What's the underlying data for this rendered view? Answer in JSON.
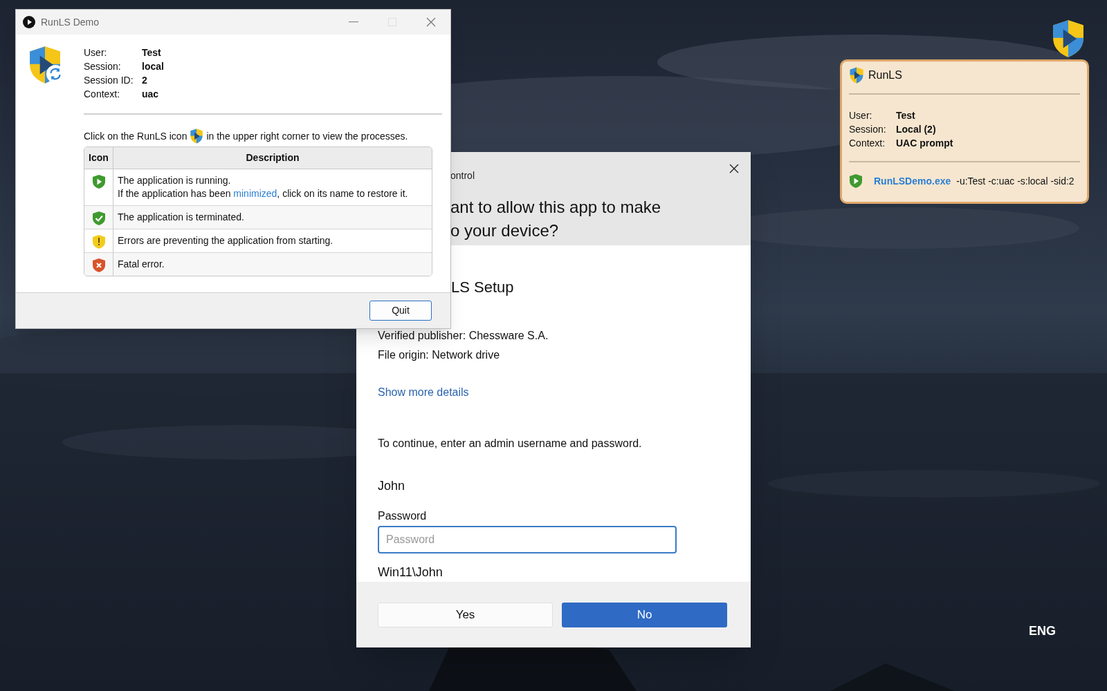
{
  "demo_window": {
    "title": "RunLS Demo",
    "fields": [
      {
        "label": "User:",
        "value": "Test"
      },
      {
        "label": "Session:",
        "value": "local"
      },
      {
        "label": "Session ID:",
        "value": "2"
      },
      {
        "label": "Context:",
        "value": "uac"
      }
    ],
    "hint_before": "Click on the RunLS icon",
    "hint_after": "in the upper right corner to view the processes.",
    "table": {
      "columns": [
        "Icon",
        "Description"
      ],
      "rows": [
        {
          "kind": "running",
          "lines": [
            {
              "text": "The application is running."
            },
            {
              "before": "If the application has been ",
              "link": "minimized",
              "after": ", click on its name to restore it."
            }
          ]
        },
        {
          "kind": "terminated",
          "lines": [
            {
              "text": "The application is terminated."
            }
          ]
        },
        {
          "kind": "warning",
          "lines": [
            {
              "text": "Errors are preventing the application from starting."
            }
          ]
        },
        {
          "kind": "error",
          "lines": [
            {
              "text": "Fatal error."
            }
          ]
        }
      ]
    },
    "button": "Quit"
  },
  "tray_tooltip": {
    "title": "RunLS",
    "fields": [
      {
        "label": "User:",
        "value": "Test"
      },
      {
        "label": "Session:",
        "value": "Local (2)"
      },
      {
        "label": "Context:",
        "value": "UAC prompt"
      }
    ],
    "process": {
      "kind": "running",
      "name": "RunLSDemo.exe",
      "args": "-u:Test -c:uac -s:local -sid:2"
    }
  },
  "uac_dialog": {
    "title": "ontrol",
    "question": [
      "ant to allow this app to make",
      "o your device?"
    ],
    "app_name": "LS Setup",
    "publisher": "Verified publisher: Chessware S.A.",
    "origin": "File origin: Network drive",
    "details_link": "Show more details",
    "prompt": "To continue, enter an admin username and password.",
    "username": "John",
    "password_label": "Password",
    "password_placeholder": "Password",
    "account": "Win11\\John",
    "buttons": [
      {
        "label": "Yes",
        "primary": false
      },
      {
        "label": "No",
        "primary": true
      }
    ]
  },
  "desktop": {
    "language": "ENG"
  }
}
